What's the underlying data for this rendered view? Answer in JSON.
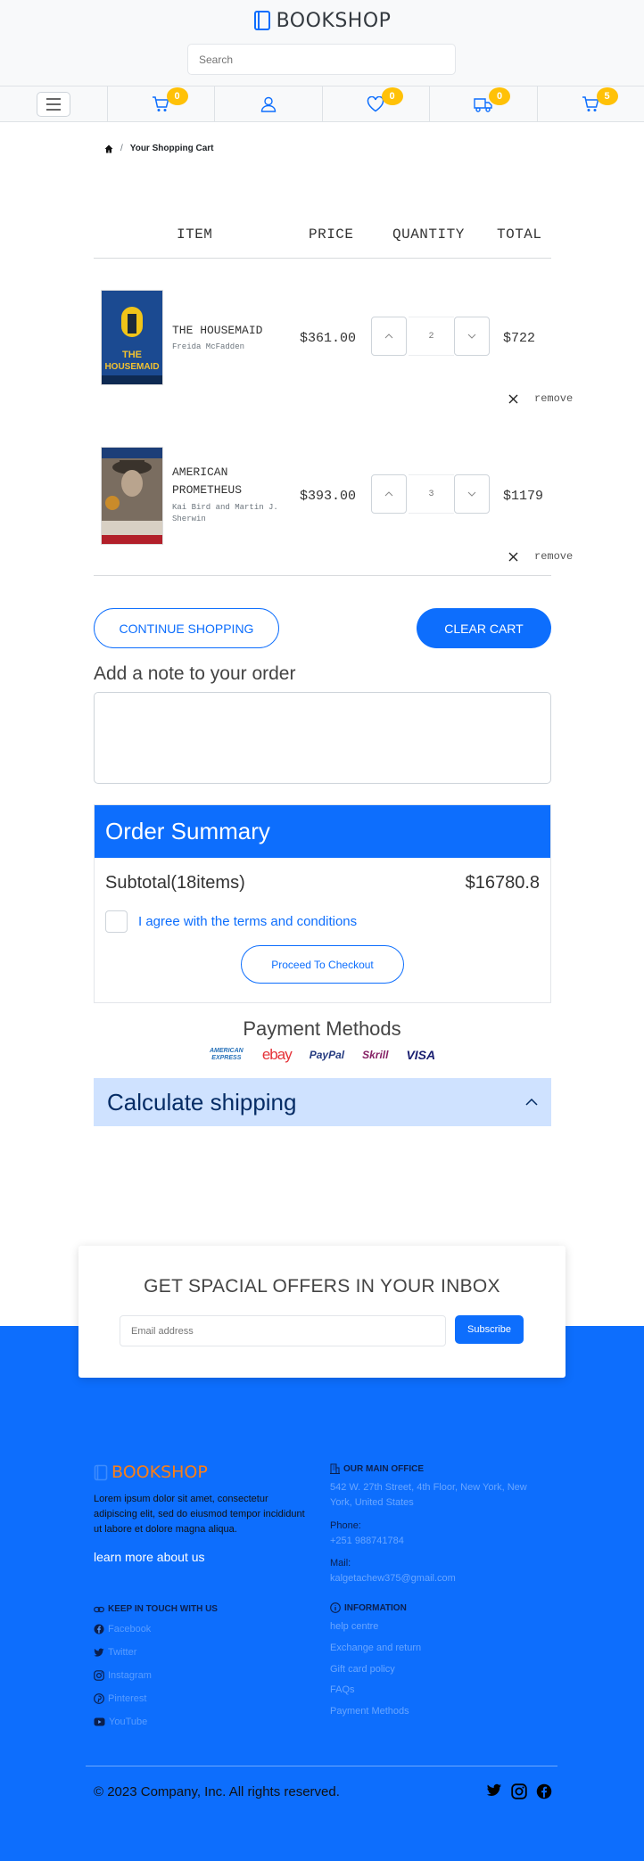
{
  "header": {
    "brand": "BOOKSHOP",
    "search_placeholder": "Search",
    "badges": {
      "cart1": "0",
      "wishlist": "0",
      "truck": "0",
      "cart2": "5"
    }
  },
  "breadcrumb": {
    "current": "Your Shopping Cart"
  },
  "cart": {
    "columns": {
      "item": "ITEM",
      "price": "PRICE",
      "quantity": "QUANTITY",
      "total": "TOTAL"
    },
    "items": [
      {
        "title": "THE HOUSEMAID",
        "author": "Freida McFadden",
        "price": "$361.00",
        "quantity": "2",
        "total": "$722",
        "remove": "remove"
      },
      {
        "title": "AMERICAN PROMETHEUS",
        "author": "Kai Bird and Martin J. Sherwin",
        "price": "$393.00",
        "quantity": "3",
        "total": "$1179",
        "remove": "remove"
      }
    ],
    "continue_label": "CONTINUE SHOPPING",
    "clear_label": "CLEAR CART",
    "note_label": "Add a note to your order"
  },
  "summary": {
    "title": "Order Summary",
    "subtotal_label": "Subtotal(18items)",
    "subtotal_value": "$16780.8",
    "agree_label": "I agree with the terms and conditions",
    "checkout_label": "Proceed To Checkout"
  },
  "payment": {
    "title": "Payment Methods",
    "methods": [
      "AMERICAN EXPRESS",
      "ebay",
      "PayPal",
      "Skrill",
      "VISA"
    ]
  },
  "shipping": {
    "title": "Calculate shipping"
  },
  "newsletter": {
    "title": "GET SPACIAL OFFERS IN YOUR INBOX",
    "placeholder": "Email address",
    "subscribe": "Subscribe"
  },
  "footer": {
    "brand": "BOOKSHOP",
    "about": "Lorem ipsum dolor sit amet, consectetur adipiscing elit, sed do eiusmod tempor incididunt ut labore et dolore magna aliqua.",
    "learn_more": "learn more about us",
    "office_title": "OUR MAIN OFFICE",
    "address": "542 W. 27th Street, 4th Floor, New York, New York, United States",
    "phone_label": "Phone:",
    "phone": "+251 988741784",
    "mail_label": "Mail:",
    "mail": "kalgetachew375@gmail.com",
    "social_title": "KEEP IN TOUCH WITH US",
    "social": [
      "Facebook",
      "Twitter",
      "Instagram",
      "Pinterest",
      "YouTube"
    ],
    "info_title": "INFORMATION",
    "info": [
      "help centre",
      "Exchange and return",
      "Gift card policy",
      "FAQs",
      "Payment Methods"
    ],
    "copyright": "© 2023 Company, Inc. All rights reserved."
  },
  "colors": {
    "primary": "#0d6efd",
    "badge": "#ffc107",
    "brand_orange": "#fd7e14",
    "shipping_bg": "#cfe2ff"
  },
  "icons": [
    "book-icon",
    "menu-icon",
    "cart-icon",
    "user-icon",
    "heart-icon",
    "truck-icon",
    "home-icon",
    "chevron-up-icon",
    "chevron-down-icon",
    "close-icon",
    "building-icon",
    "info-icon",
    "link-icon",
    "facebook-icon",
    "twitter-icon",
    "instagram-icon",
    "pinterest-icon",
    "youtube-icon"
  ]
}
